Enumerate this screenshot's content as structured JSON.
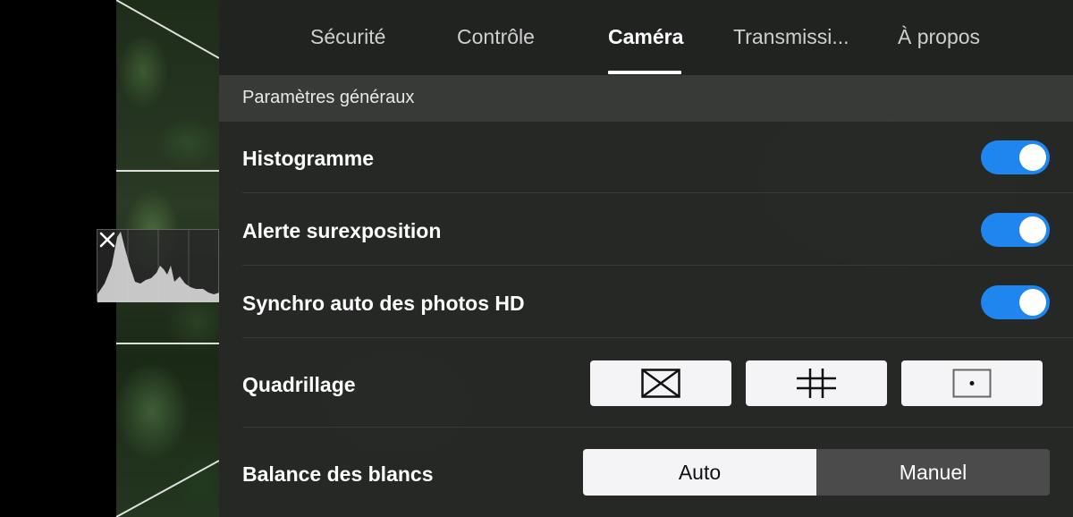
{
  "tabs": [
    {
      "label": "Sécurité",
      "active": false
    },
    {
      "label": "Contrôle",
      "active": false
    },
    {
      "label": "Caméra",
      "active": true
    },
    {
      "label": "Transmissi...",
      "active": false
    },
    {
      "label": "À propos",
      "active": false
    }
  ],
  "section": {
    "title": "Paramètres généraux"
  },
  "settings": {
    "histogram": {
      "label": "Histogramme",
      "on": true
    },
    "overexposure": {
      "label": "Alerte surexposition",
      "on": true
    },
    "hd_sync": {
      "label": "Synchro auto des photos HD",
      "on": true
    },
    "grid": {
      "label": "Quadrillage",
      "options": [
        "grid-diagonal-icon",
        "grid-3x3-icon",
        "grid-center-dot-icon"
      ]
    },
    "white_balance": {
      "label": "Balance des blancs",
      "options": [
        "Auto",
        "Manuel"
      ],
      "selected": "Auto"
    }
  },
  "colors": {
    "accent": "#1f86f0",
    "panel": "#2b2d2b",
    "button": "#f4f4f6"
  }
}
